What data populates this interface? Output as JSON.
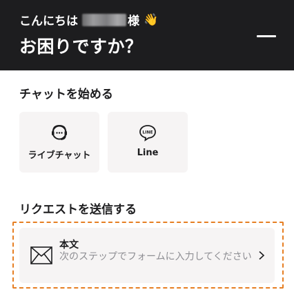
{
  "header": {
    "greeting_prefix": "こんにちは",
    "greeting_suffix": "様",
    "wave_emoji": "👋",
    "title": "お困りですか？",
    "minimize_icon": "minimize-icon"
  },
  "start_chat": {
    "heading": "チャットを始める",
    "options": [
      {
        "label": "ライブチャット",
        "icon": "live-chat-icon"
      },
      {
        "label": "Line",
        "icon": "line-icon"
      }
    ]
  },
  "request": {
    "heading": "リクエストを送信する",
    "item": {
      "title": "本文",
      "description": "次のステップでフォームに入力してください",
      "icon": "mail-icon",
      "chevron": "chevron-right-icon"
    }
  },
  "colors": {
    "header_bg": "#1d1d1f",
    "card_bg": "#f6f4f4",
    "highlight_border": "#e67e22",
    "muted_text": "#8e8e93"
  }
}
